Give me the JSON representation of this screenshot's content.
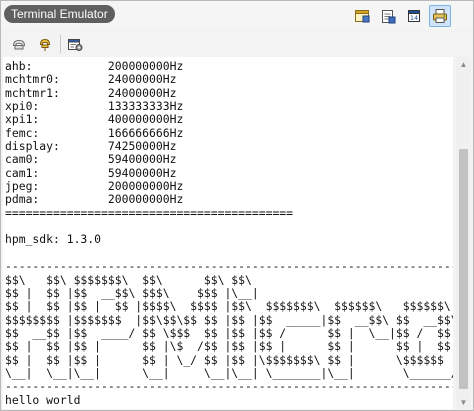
{
  "window": {
    "title": "Terminal Emulator"
  },
  "titlebar_icons": [
    "window-icon",
    "clipboard-icon",
    "calendar-icon",
    "printer-icon"
  ],
  "toolbar_icons": [
    "disconnect-icon",
    "connect-icon",
    "settings-icon"
  ],
  "terminal": {
    "lines": [
      "ahb:           200000000Hz",
      "mchtmr0:       24000000Hz",
      "mchtmr1:       24000000Hz",
      "xpi0:          133333333Hz",
      "xpi1:          400000000Hz",
      "femc:          166666666Hz",
      "display:       74250000Hz",
      "cam0:          59400000Hz",
      "cam1:          59400000Hz",
      "jpeg:          200000000Hz",
      "pdma:          200000000Hz",
      "==========================================",
      "",
      "hpm_sdk: 1.3.0",
      "",
      "-----------------------------------------------------------------------------",
      "$$\\   $$\\ $$$$$$$\\  $$\\      $$\\ $$\\",
      "$$ |  $$ |$$  __$$\\ $$$\\    $$$ |\\__|",
      "$$ |  $$ |$$ |  $$ |$$$$\\  $$$$ |$$\\  $$$$$$$\\  $$$$$$\\   $$$$$$\\",
      "$$$$$$$$ |$$$$$$$  |$$\\$$\\$$ $$ |$$ |$$  _____|$$  __$$\\ $$  __$$\\",
      "$$  __$$ |$$  ____/ $$ \\$$$  $$ |$$ |$$ /      $$ |  \\__|$$ /  $$ |",
      "$$ |  $$ |$$ |      $$ |\\$  /$$ |$$ |$$ |      $$ |      $$ |  $$ |",
      "$$ |  $$ |$$ |      $$ | \\_/ $$ |$$ |\\$$$$$$$\\ $$ |      \\$$$$$$  |",
      "\\__|  \\__|\\__|      \\__|     \\__|\\__| \\_______|\\__|       \\______/",
      "-----------------------------------------------------------------------------",
      "hello world"
    ]
  }
}
